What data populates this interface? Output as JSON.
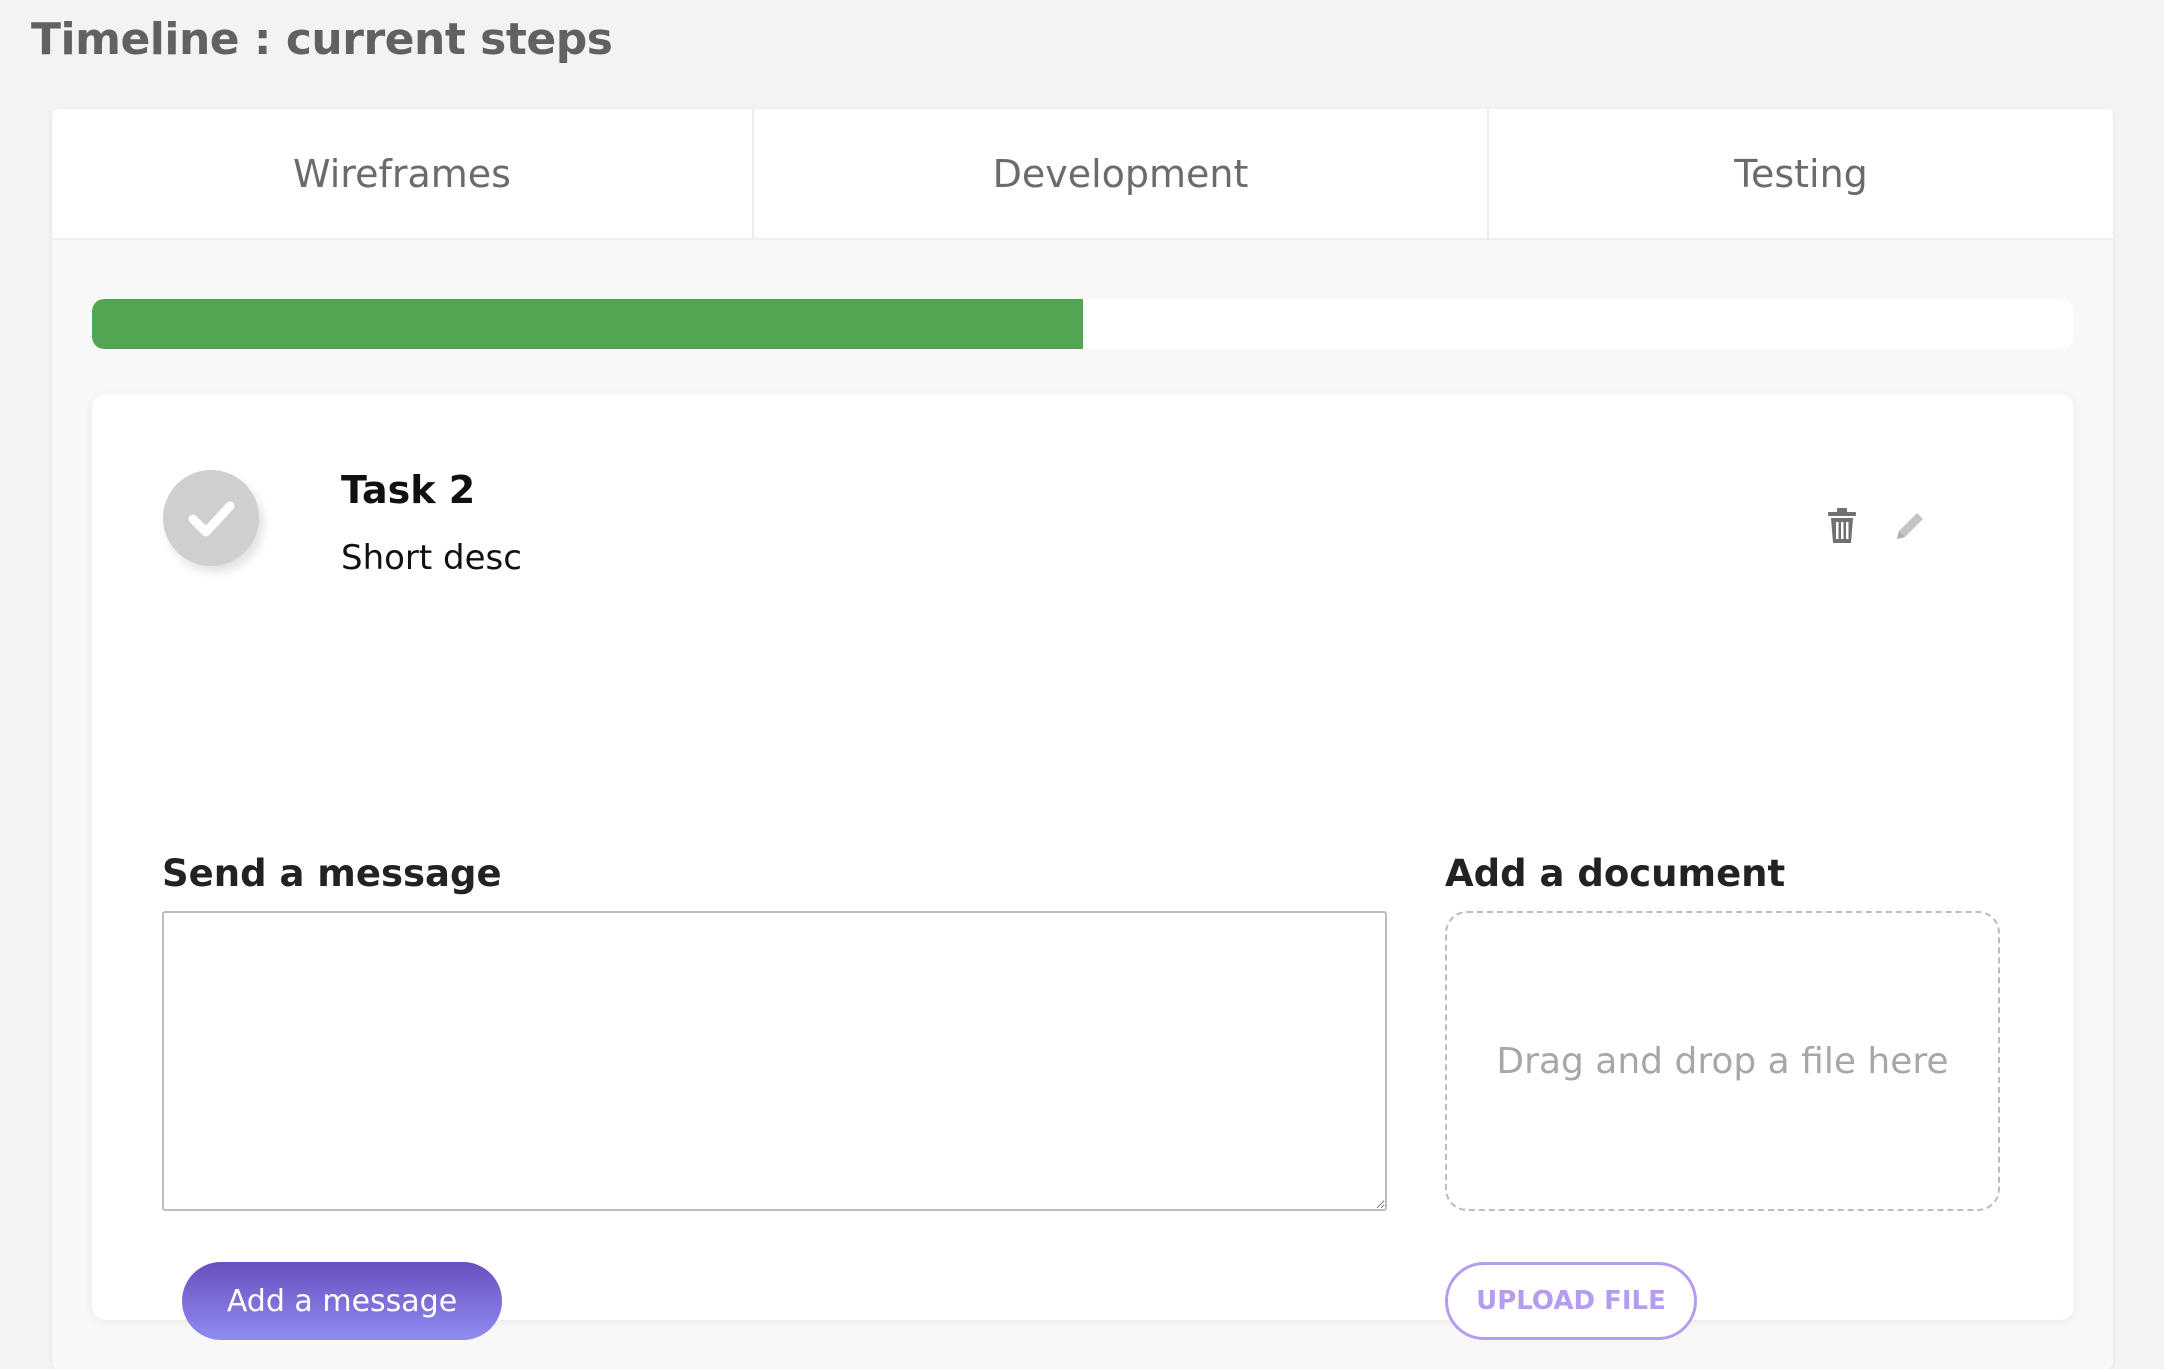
{
  "page": {
    "title": "Timeline : current steps"
  },
  "tabs": [
    {
      "label": "Wireframes"
    },
    {
      "label": "Development"
    },
    {
      "label": "Testing"
    }
  ],
  "progress": {
    "value_percent": 50,
    "color": "#52a552"
  },
  "task": {
    "title": "Task 2",
    "description": "Short desc",
    "status_icon": "check-icon",
    "actions": {
      "delete_icon": "trash-icon",
      "edit_icon": "pencil-icon"
    }
  },
  "message": {
    "label": "Send a message",
    "value": "",
    "placeholder": "",
    "button_label": "Add a message"
  },
  "document": {
    "label": "Add a document",
    "dropzone_text": "Drag and drop a file here",
    "button_label": "UPLOAD FILE"
  },
  "colors": {
    "accent_purple": "#6a4fbf",
    "upload_outline": "#b69cf0",
    "success_green": "#52a552"
  }
}
